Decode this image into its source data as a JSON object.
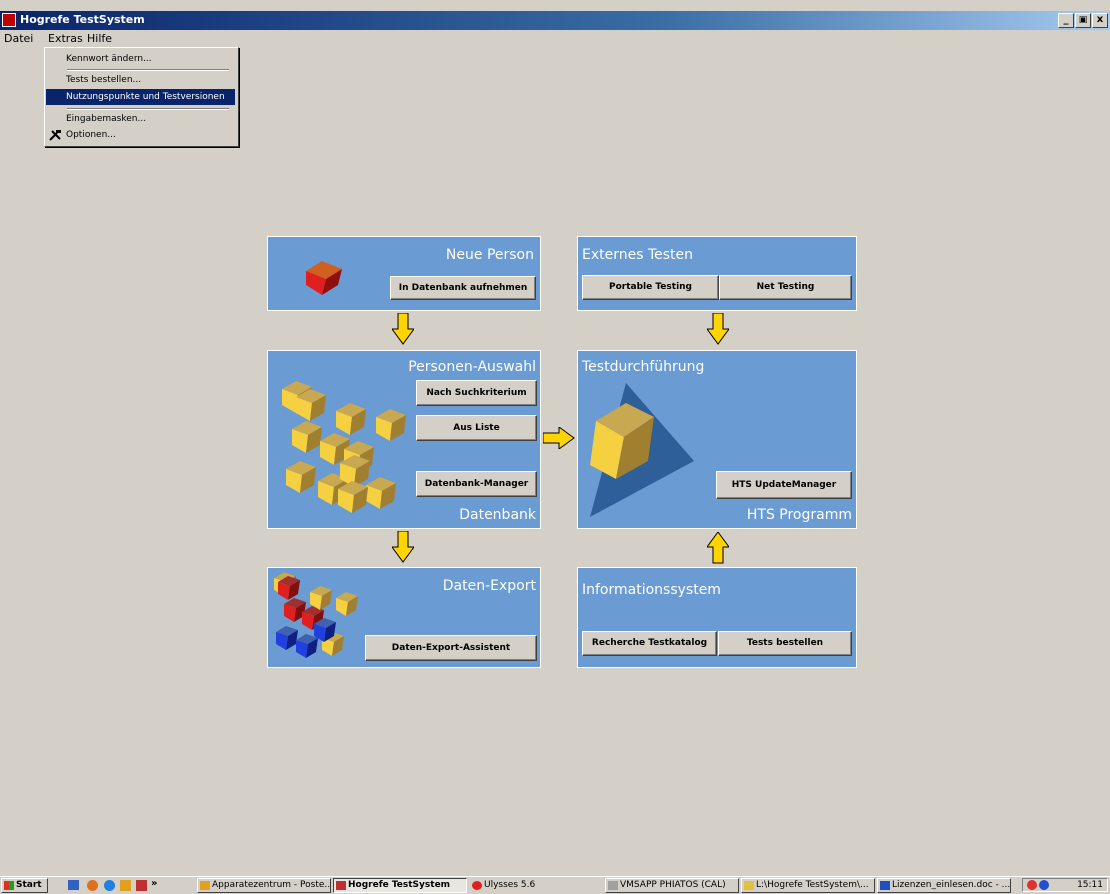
{
  "window": {
    "title": "Hogrefe TestSystem",
    "min": "_",
    "max": "̲̲",
    "close": "x"
  },
  "menubar": {
    "items": [
      "Datei",
      "Extras",
      "Hilfe"
    ]
  },
  "extras_menu": {
    "items": [
      "Kennwort ändern...",
      "Tests bestellen...",
      "Nutzungspunkte und Testversionen",
      "Eingabemasken...",
      "Optionen..."
    ],
    "highlighted": "Nutzungspunkte und Testversionen"
  },
  "panels": {
    "neue_person": {
      "title": "Neue Person",
      "button": "In Datenbank aufnehmen"
    },
    "externes_testen": {
      "title": "Externes Testen",
      "buttons": [
        "Portable Testing",
        "Net Testing"
      ]
    },
    "personen_auswahl": {
      "title": "Personen-Auswahl",
      "footer": "Datenbank",
      "buttons": [
        "Nach Suchkriterium",
        "Aus Liste",
        "Datenbank-Manager"
      ]
    },
    "testdurchfuehrung": {
      "title": "Testdurchführung",
      "footer": "HTS Programm",
      "button": "HTS UpdateManager"
    },
    "daten_export": {
      "title": "Daten-Export",
      "button": "Daten-Export-Assistent"
    },
    "informationssystem": {
      "title": "Informationssystem",
      "buttons": [
        "Recherche Testkatalog",
        "Tests bestellen"
      ]
    }
  },
  "colors": {
    "panel": "#6a9bd2",
    "arrow": "#ffd400",
    "desktop": "#d4d0c8"
  },
  "taskbar": {
    "start": "Start",
    "quick_more": "»",
    "items": [
      {
        "label": "Apparatezentrum - Poste...",
        "active": false
      },
      {
        "label": "Hogrefe TestSystem",
        "active": true
      },
      {
        "label": "Ulysses 5.6",
        "active": false
      },
      {
        "label": "VMSAPP PHIATOS (CAL)",
        "active": false
      },
      {
        "label": "L:\\Hogrefe TestSystem\\...",
        "active": false
      },
      {
        "label": "Lizenzen_einlesen.doc - ...",
        "active": false
      }
    ],
    "clock": "15:11"
  }
}
